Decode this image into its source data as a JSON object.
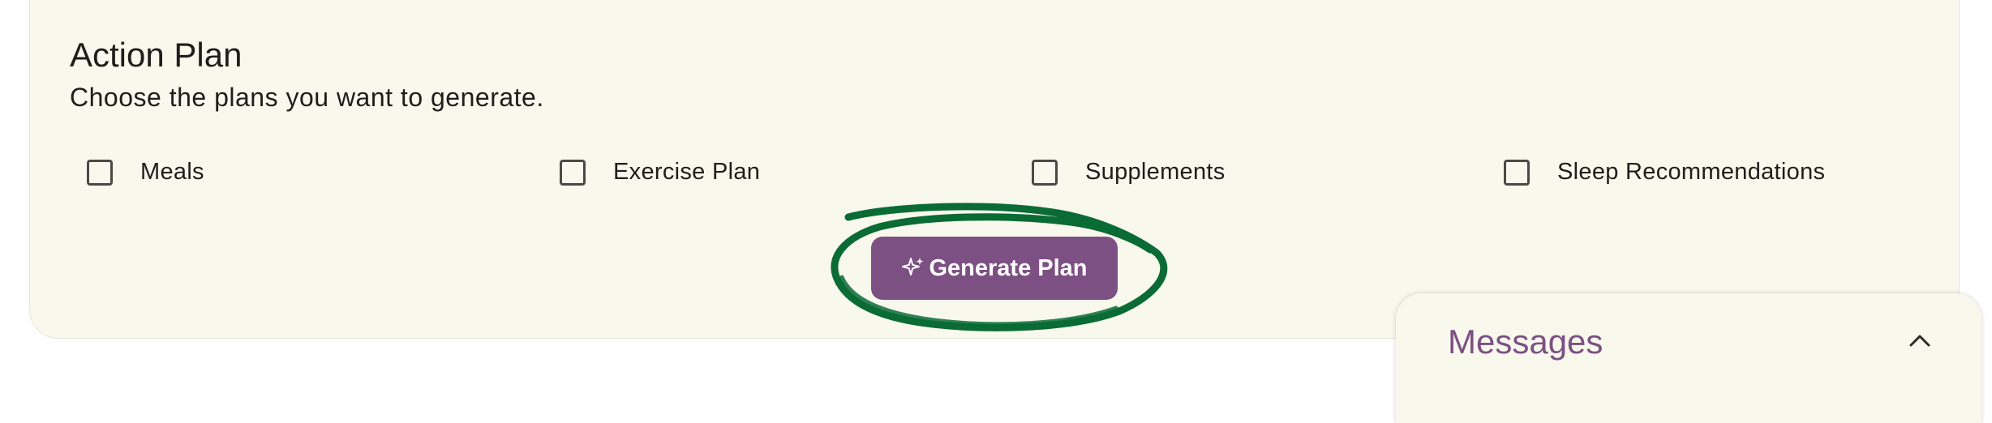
{
  "action_plan": {
    "title": "Action Plan",
    "subtitle": "Choose the plans you want to generate.",
    "options": [
      {
        "label": "Meals",
        "checked": false
      },
      {
        "label": "Exercise Plan",
        "checked": false
      },
      {
        "label": "Supplements",
        "checked": false
      },
      {
        "label": "Sleep Recommendations",
        "checked": false
      }
    ],
    "generate_button_label": "Generate Plan"
  },
  "messages": {
    "title": "Messages"
  },
  "colors": {
    "card_bg": "#f8f8ed",
    "accent_purple": "#7c5083",
    "highlight_green": "#0a6b35",
    "text": "#1e1e1b"
  },
  "icons": {
    "generate": "sparkle-icon",
    "messages_toggle": "chevron-up-icon"
  }
}
